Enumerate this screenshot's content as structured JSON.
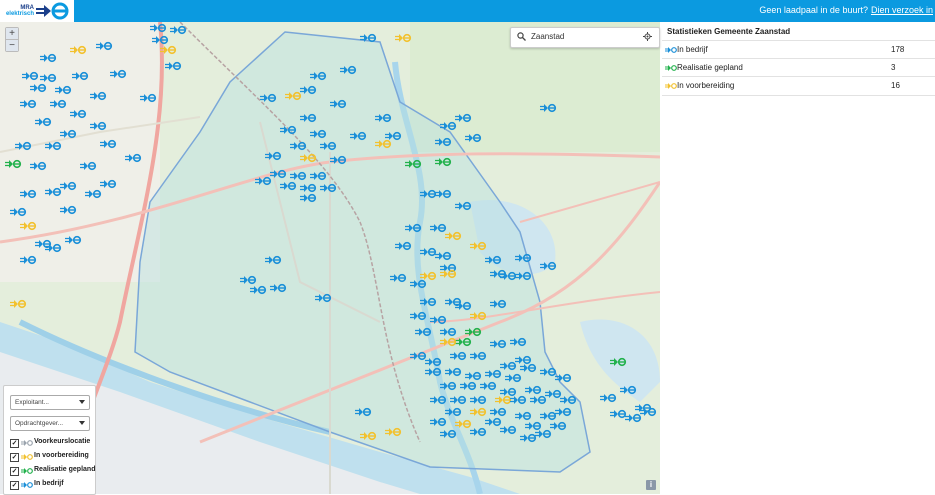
{
  "header": {
    "logo_line1": "MRA",
    "logo_line2": "elektrisch",
    "message": "Geen laadpaal in de buurt?",
    "link": "Dien verzoek in"
  },
  "map": {
    "search_value": "Zaanstad",
    "zoom_in": "+",
    "zoom_out": "−",
    "info_label": "i",
    "colors": {
      "in_bedrijf": "#1a8fd8",
      "in_voorbereiding": "#f2c12e",
      "realisatie_gepland": "#22b14c",
      "voorkeur": "#9aa3ad"
    }
  },
  "stats": {
    "title": "Statistieken Gemeente Zaanstad",
    "rows": [
      {
        "label": "In bedrijf",
        "count": "178",
        "icon": "plug-blue-icon"
      },
      {
        "label": "Realisatie gepland",
        "count": "3",
        "icon": "plug-green-icon"
      },
      {
        "label": "In voorbereiding",
        "count": "16",
        "icon": "plug-yellow-icon"
      }
    ]
  },
  "filters": {
    "exploitant": "Exploitant...",
    "opdrachtgever": "Opdrachtgever...",
    "legend": [
      {
        "label": "Voorkeurslocatie",
        "checked": true
      },
      {
        "label": "In voorbereiding",
        "checked": true
      },
      {
        "label": "Realisatie gepland",
        "checked": true
      },
      {
        "label": "In bedrijf",
        "checked": true
      }
    ]
  }
}
